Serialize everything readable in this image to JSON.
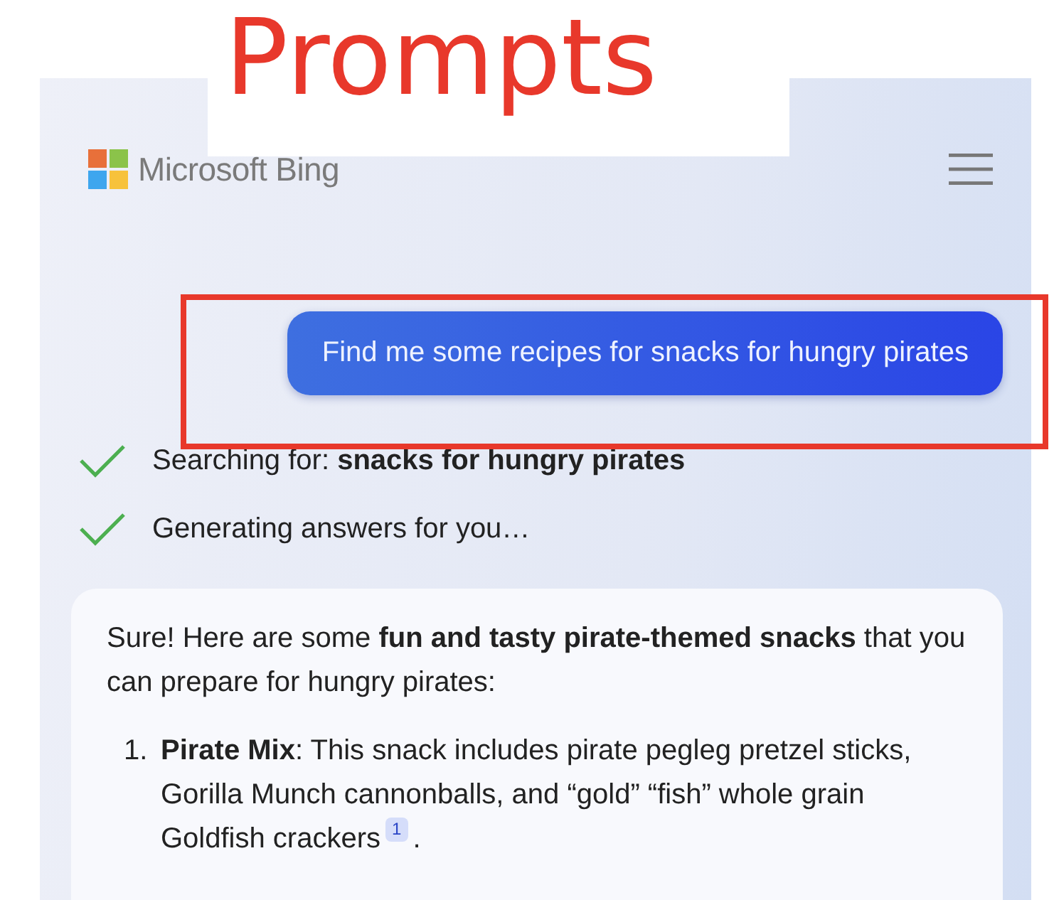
{
  "annotation": {
    "label": "Prompts",
    "highlight_prompt": true
  },
  "header": {
    "brand": "Microsoft Bing"
  },
  "prompt": "Find me some recipes for snacks for hungry pirates",
  "steps": [
    {
      "text": "Searching for: **snacks for hungry pirates**",
      "done": true
    },
    {
      "text": "Generating answers for you…",
      "done": true
    }
  ],
  "answer": {
    "intro": "Sure! Here are some **fun and tasty pirate-themed snacks** that you can prepare for hungry pirates:",
    "items": [
      {
        "number": "1.",
        "text": "**Pirate Mix**: This snack includes pirate pegleg pretzel sticks, Gorilla Munch cannonballs, and “gold” “fish” whole grain Goldfish crackers",
        "citation": "1",
        "after": "."
      }
    ]
  }
}
